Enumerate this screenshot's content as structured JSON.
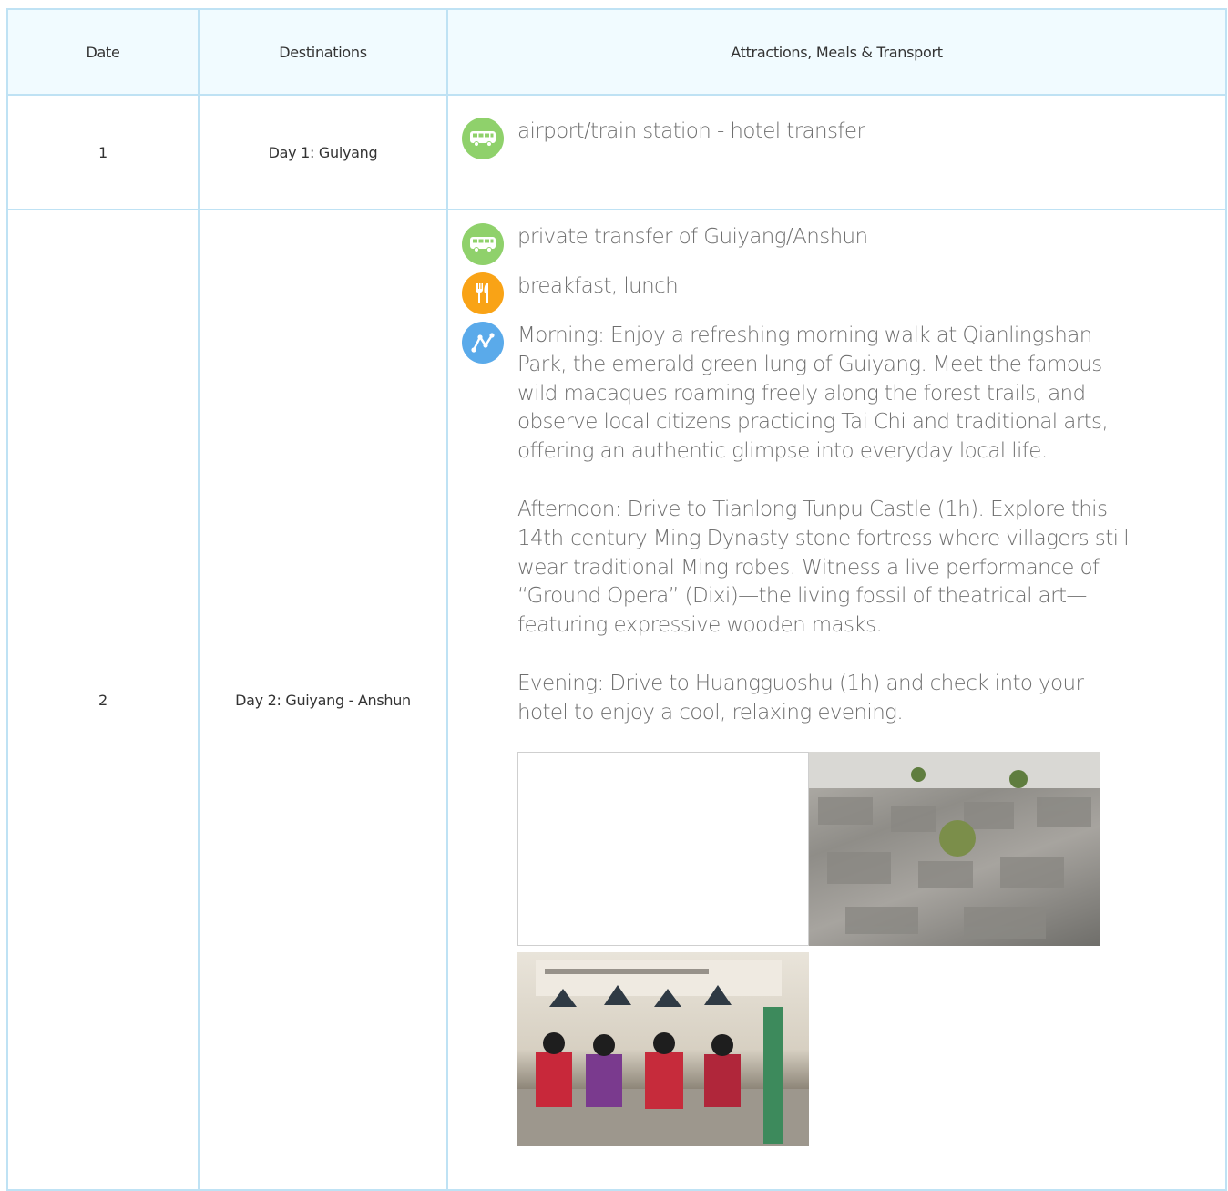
{
  "table": {
    "headers": [
      "Date",
      "Destinations",
      "Attractions, Meals & Transport"
    ],
    "rows": [
      {
        "date": "1",
        "destination": "Day 1: Guiyang",
        "items": [
          {
            "icon": "bus-icon",
            "text": "airport/train station - hotel transfer"
          }
        ]
      },
      {
        "date": "2",
        "destination": "Day 2: Guiyang - Anshun",
        "items": [
          {
            "icon": "bus-icon",
            "text": "private transfer of Guiyang/Anshun"
          },
          {
            "icon": "fork-knife-icon",
            "text": "breakfast, lunch"
          },
          {
            "icon": "route-icon",
            "paragraphs": [
              "Morning: Enjoy a refreshing morning walk at Qianlingshan Park, the emerald green lung of Guiyang. Meet the famous wild macaques roaming freely along the forest trails, and observe local citizens practicing Tai Chi and traditional arts, offering an authentic glimpse into everyday local life.",
              "Afternoon: Drive to Tianlong Tunpu Castle (1h). Explore this 14th-century Ming Dynasty stone fortress where villagers still wear traditional Ming robes. Witness a live performance of “Ground Opera” (Dixi)—the living fossil of theatrical art—featuring expressive wooden masks.",
              "Evening: Drive to Huangguoshu (1h) and check into your hotel to enjoy a cool, relaxing evening."
            ]
          }
        ]
      }
    ]
  },
  "colors": {
    "border": "#bfe2f4",
    "header_bg": "#f1fbff",
    "bus": "#8fd16b",
    "meal": "#f9a316",
    "route": "#5aaaea"
  }
}
